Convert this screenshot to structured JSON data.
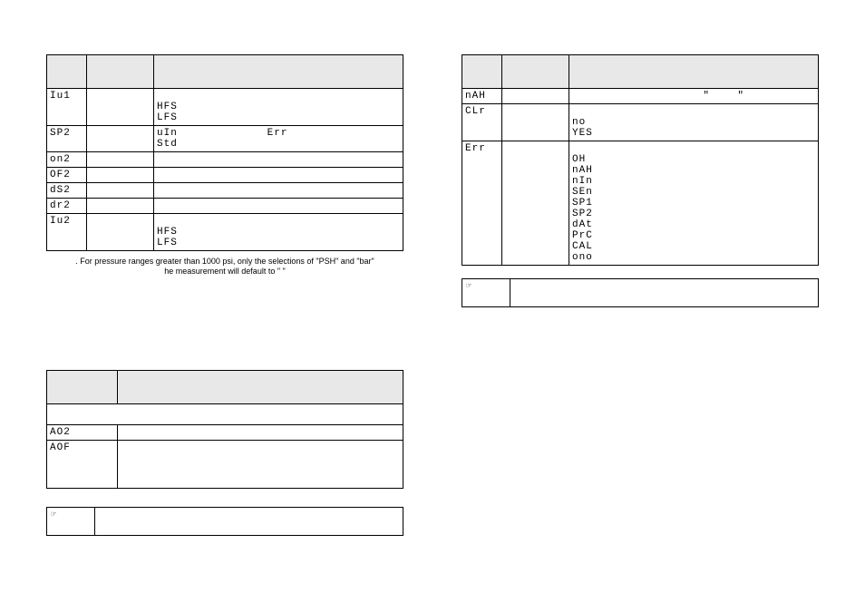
{
  "left_table1": {
    "headers": [
      "",
      "",
      ""
    ],
    "rows": [
      {
        "code": "Iu1",
        "mid": "",
        "opts": "\nHFS\nLFS"
      },
      {
        "code": "SP2",
        "mid": "",
        "opts": "uIn             Err\nStd"
      },
      {
        "code": "on2",
        "mid": "",
        "opts": ""
      },
      {
        "code": "OF2",
        "mid": "",
        "opts": ""
      },
      {
        "code": "dS2",
        "mid": "",
        "opts": ""
      },
      {
        "code": "dr2",
        "mid": "",
        "opts": ""
      },
      {
        "code": "Iu2",
        "mid": "",
        "opts": "\nHFS\nLFS"
      }
    ]
  },
  "left_note": ". For pressure ranges greater than 1000 psi, only the selections of \"PSH\" and \"bar\"\nhe measurement will default to \"      \"",
  "left_table2": {
    "headers": [
      "",
      ""
    ],
    "span_label": "",
    "rows": [
      {
        "code": "AO2",
        "opts": ""
      },
      {
        "code": "AOF",
        "opts": "\n\n\n\n"
      }
    ]
  },
  "left_bar_icon": "☞",
  "right_table": {
    "headers": [
      "",
      "",
      ""
    ],
    "rows": [
      {
        "code": "nAH",
        "mid": "",
        "opts": "                   \"    \""
      },
      {
        "code": "CLr",
        "mid": "",
        "opts": "\nno\nYES"
      },
      {
        "code": "Err",
        "mid": "",
        "opts": "\nOH\nnAH\nnIn\nSEn\nSP1\nSP2\ndAt\nPrC\nCAL\nono"
      }
    ]
  },
  "right_bar_icon": "☞"
}
